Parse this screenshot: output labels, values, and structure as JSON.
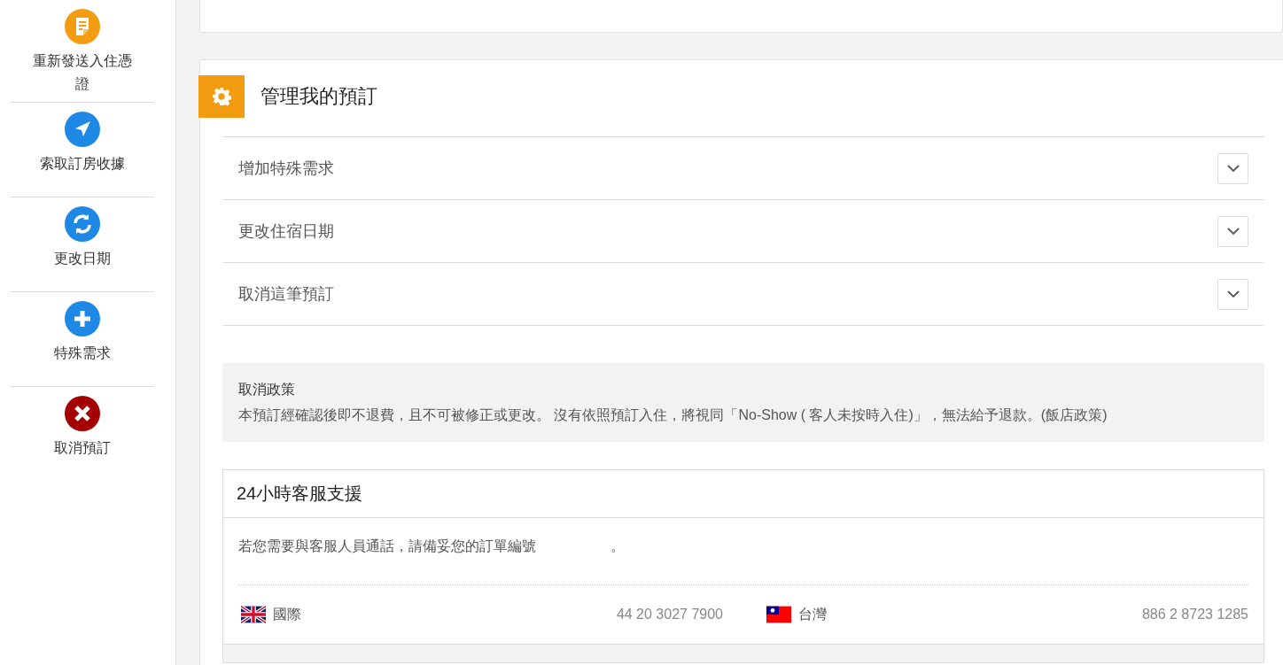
{
  "sidebar": {
    "items": [
      {
        "kind": "voucher",
        "label": "重新發送入住憑證"
      },
      {
        "kind": "receipt",
        "label": "索取訂房收據"
      },
      {
        "kind": "dates",
        "label": "更改日期"
      },
      {
        "kind": "request",
        "label": "特殊需求"
      },
      {
        "kind": "cancel",
        "label": "取消預訂"
      }
    ]
  },
  "manage": {
    "title": "管理我的預訂",
    "sections": [
      {
        "label": "增加特殊需求",
        "expanded": false
      },
      {
        "label": "更改住宿日期",
        "expanded": false
      },
      {
        "label": "取消這筆預訂",
        "expanded": false
      }
    ],
    "policy": {
      "title": "取消政策",
      "text": "本預訂經確認後即不退費，且不可被修正或更改。 沒有依照預訂入住，將視同「No-Show ( 客人未按時入住)」，無法給予退款。(飯店政策)"
    },
    "support": {
      "title": "24小時客服支援",
      "message": "若您需要與客服人員通話，請備妥您的訂單編號",
      "message_end": "。",
      "contacts": [
        {
          "kind": "uk",
          "label": "國際",
          "phone": "44 20 3027 7900"
        },
        {
          "kind": "tw",
          "label": "台灣",
          "phone": "886 2 8723 1285"
        }
      ]
    }
  }
}
